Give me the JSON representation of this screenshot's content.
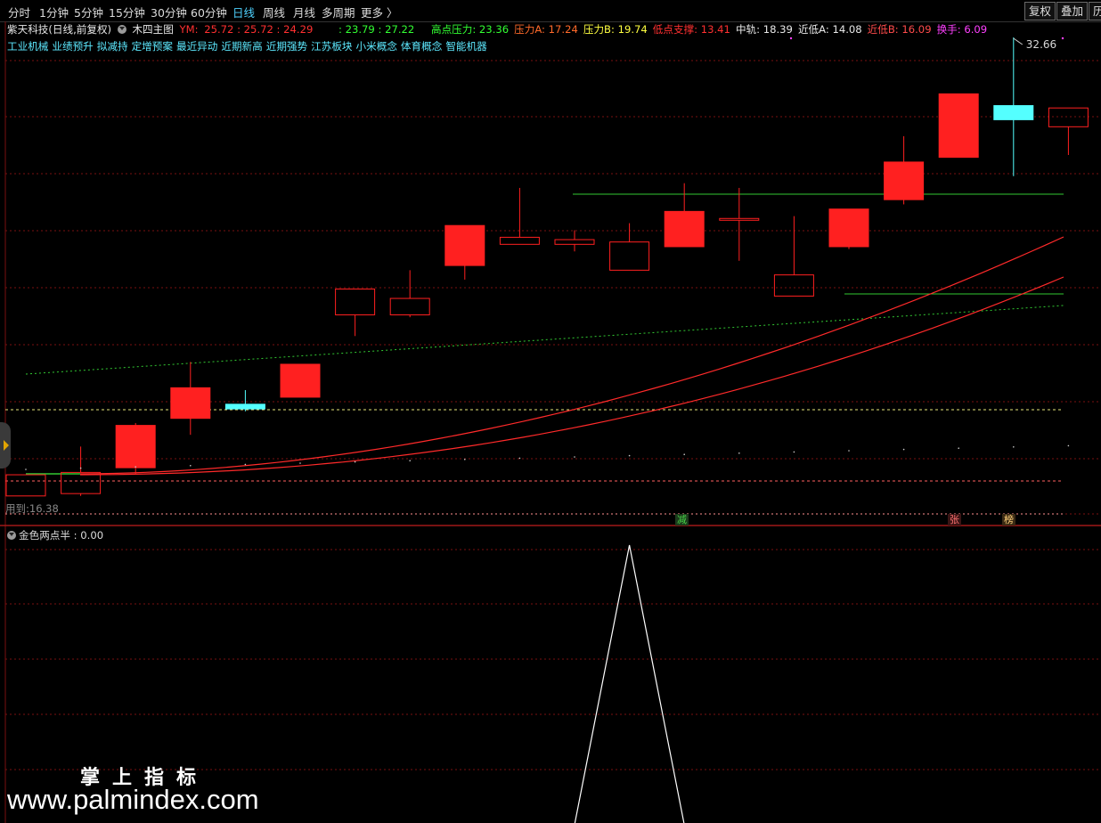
{
  "tabs": [
    "分时",
    "1分钟",
    "5分钟",
    "15分钟",
    "30分钟",
    "60分钟",
    "日线",
    "周线",
    "月线",
    "多周期",
    "更多 〉"
  ],
  "active_tab": "日线",
  "right_buttons": [
    "复权",
    "叠加",
    "历"
  ],
  "info_line": {
    "stock": "紫天科技(日线,前复权)",
    "indicator": "木四主图",
    "ym_label": "YM:",
    "ym_values": "25.72 : 25.72 : 24.29",
    "ym_values2": ": 23.79 : 27.22",
    "items": [
      {
        "label": "高点压力:",
        "value": "23.36",
        "color": "#32ff32"
      },
      {
        "label": "压力A:",
        "value": "17.24",
        "color": "#ff6a2a"
      },
      {
        "label": "压力B:",
        "value": "19.74",
        "color": "#ffff40"
      },
      {
        "label": "低点支撑:",
        "value": "13.41",
        "color": "#ff3030"
      },
      {
        "label": "中轨:",
        "value": "18.39",
        "color": "#e8e8e8"
      },
      {
        "label": "近低A:",
        "value": "14.08",
        "color": "#e8e8e8"
      },
      {
        "label": "近低B:",
        "value": "16.09",
        "color": "#ff4b4b"
      },
      {
        "label": "换手:",
        "value": "6.09",
        "color": "#ff40ff"
      }
    ]
  },
  "concepts": [
    "工业机械",
    "业绩预升",
    "拟减持",
    "定增预案",
    "最近异动",
    "近期新高",
    "近期强势",
    "江苏板块",
    "小米概念",
    "体育概念",
    "智能机器"
  ],
  "high_label": "32.66",
  "left_note": "用到:16.38",
  "markers": [
    {
      "text": "减",
      "color": "#46d246",
      "bg": "#1c3a1c"
    },
    {
      "text": "张",
      "color": "#ff7070",
      "bg": "#3a1414"
    },
    {
      "text": "榜",
      "color": "#ffd07a",
      "bg": "#3a2a14"
    }
  ],
  "sub_indicator": {
    "name": "金色两点半",
    "value": "0.00"
  },
  "watermark": {
    "cn": "掌上指标",
    "url": "www.palmindex.com"
  },
  "colors": {
    "up": "#ff2020",
    "down_doji": "#54ffff",
    "green_line": "#32c832",
    "grid": "#7a1010"
  },
  "candles": [
    {
      "o": 16.9,
      "c": 16.0,
      "h": 16.9,
      "l": 16.0
    },
    {
      "o": 16.1,
      "c": 17.0,
      "h": 18.1,
      "l": 16.0
    },
    {
      "o": 17.2,
      "c": 19.0,
      "h": 19.1,
      "l": 16.9
    },
    {
      "o": 19.3,
      "c": 20.6,
      "h": 21.7,
      "l": 18.6
    },
    {
      "o": 19.7,
      "c": 19.9,
      "h": 20.5,
      "l": 19.6
    },
    {
      "o": 20.2,
      "c": 21.6,
      "h": 21.6,
      "l": 20.2
    },
    {
      "o": 23.7,
      "c": 24.8,
      "h": 24.8,
      "l": 22.8
    },
    {
      "o": 23.7,
      "c": 24.4,
      "h": 25.6,
      "l": 23.6
    },
    {
      "o": 25.8,
      "c": 27.5,
      "h": 27.5,
      "l": 25.2
    },
    {
      "o": 26.7,
      "c": 27.0,
      "h": 29.1,
      "l": 26.7
    },
    {
      "o": 26.7,
      "c": 26.9,
      "h": 27.3,
      "l": 26.4
    },
    {
      "o": 25.6,
      "c": 26.8,
      "h": 27.6,
      "l": 25.6
    },
    {
      "o": 26.6,
      "c": 28.1,
      "h": 29.3,
      "l": 26.6
    },
    {
      "o": 27.8,
      "c": 27.8,
      "h": 29.1,
      "l": 26.0
    },
    {
      "o": 24.5,
      "c": 25.4,
      "h": 27.9,
      "l": 24.5
    },
    {
      "o": 26.6,
      "c": 28.2,
      "h": 28.2,
      "l": 26.5
    },
    {
      "o": 28.6,
      "c": 30.2,
      "h": 31.3,
      "l": 28.4
    },
    {
      "o": 30.4,
      "c": 33.1,
      "h": 33.1,
      "l": 30.4
    },
    {
      "o": 32.6,
      "c": 32.0,
      "h": 35.5,
      "l": 29.6
    },
    {
      "o": 31.7,
      "c": 32.5,
      "h": 32.5,
      "l": 30.5
    }
  ],
  "sub_series": [
    0,
    0,
    0,
    0,
    0,
    0,
    0,
    0,
    0,
    0,
    0,
    1,
    0,
    0,
    0,
    0,
    0,
    0,
    0,
    0
  ]
}
